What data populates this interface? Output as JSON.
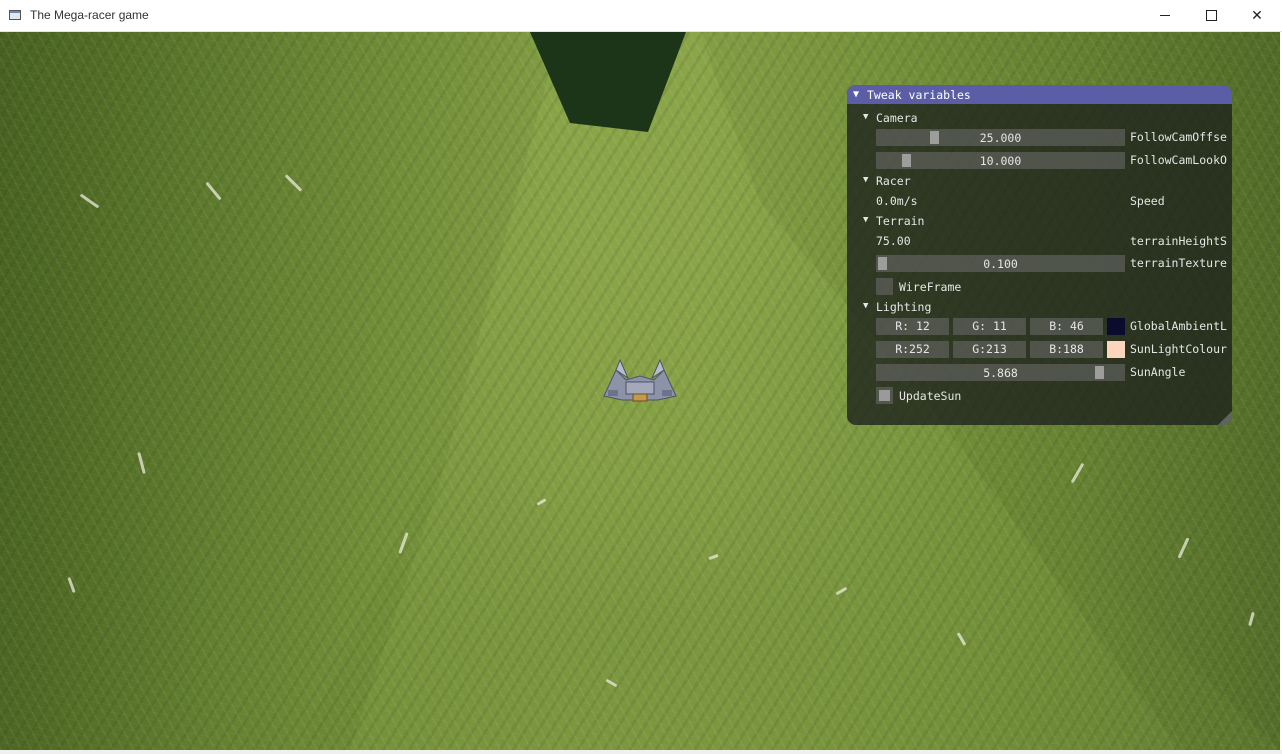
{
  "window": {
    "title": "The Mega-racer game",
    "minimize": "—",
    "maximize": "☐",
    "close": "✕"
  },
  "tweak_panel": {
    "title": "Tweak variables",
    "camera": {
      "label": "Camera",
      "follow_cam_offset": {
        "value": "25.000",
        "label": "FollowCamOffse",
        "fraction": 0.22
      },
      "follow_cam_look": {
        "value": "10.000",
        "label": "FollowCamLookO",
        "fraction": 0.1
      }
    },
    "racer": {
      "label": "Racer",
      "speed": {
        "value": "0.0m/s",
        "label": "Speed"
      }
    },
    "terrain": {
      "label": "Terrain",
      "height": {
        "value": "75.00",
        "label": "terrainHeightS"
      },
      "texture": {
        "value": "0.100",
        "label": "terrainTexture",
        "fraction": 0.0
      },
      "wireframe": {
        "label": "WireFrame",
        "checked": false
      }
    },
    "lighting": {
      "label": "Lighting",
      "ambient": {
        "r": "R: 12",
        "g": "G: 11",
        "b": "B: 46",
        "label": "GlobalAmbientL",
        "swatch": "#0c0b2e"
      },
      "sun_colour": {
        "r": "R:252",
        "g": "G:213",
        "b": "B:188",
        "label": "SunLightColour",
        "swatch": "#fcd5bc"
      },
      "sun_angle": {
        "value": "5.868",
        "label": "SunAngle",
        "fraction": 0.92
      },
      "update_sun": {
        "label": "UpdateSun",
        "checked": true
      }
    },
    "header_color": "#5b5ea7"
  }
}
